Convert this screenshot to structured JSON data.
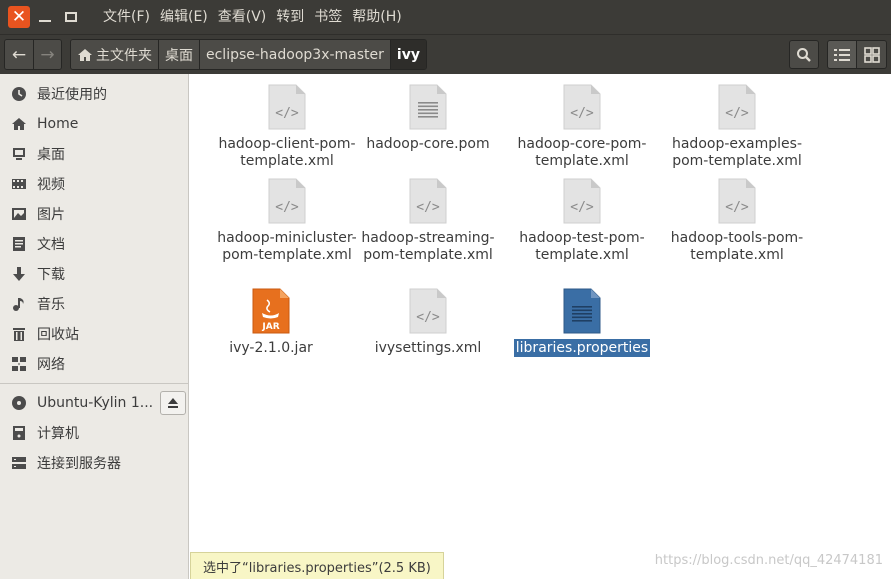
{
  "titlebar": {
    "menus": [
      "文件(F)",
      "编辑(E)",
      "查看(V)",
      "转到",
      "书签",
      "帮助(H)"
    ]
  },
  "toolbar": {
    "breadcrumbs": [
      "主文件夹",
      "桌面",
      "eclipse-hadoop3x-master",
      "ivy"
    ]
  },
  "sidebar": {
    "items": [
      "最近使用的",
      "Home",
      "桌面",
      "视频",
      "图片",
      "文档",
      "下载",
      "音乐",
      "回收站",
      "网络"
    ],
    "devices": [
      "Ubuntu-Kylin 1...",
      "计算机",
      "连接到服务器"
    ]
  },
  "files": [
    {
      "name": "hadoop-client-pom-template.xml",
      "type": "code"
    },
    {
      "name": "hadoop-core.pom",
      "type": "text"
    },
    {
      "name": "hadoop-core-pom-template.xml",
      "type": "code"
    },
    {
      "name": "hadoop-examples-pom-template.xml",
      "type": "code"
    },
    {
      "name": "hadoop-minicluster-pom-template.xml",
      "type": "code"
    },
    {
      "name": "hadoop-streaming-pom-template.xml",
      "type": "code"
    },
    {
      "name": "hadoop-test-pom-template.xml",
      "type": "code"
    },
    {
      "name": "hadoop-tools-pom-template.xml",
      "type": "code"
    },
    {
      "name": "ivy-2.1.0.jar",
      "type": "jar"
    },
    {
      "name": "ivysettings.xml",
      "type": "code"
    },
    {
      "name": "libraries.properties",
      "type": "text-selected"
    }
  ],
  "jar_badge": "JAR",
  "status": "选中了“libraries.properties”(2.5 KB)",
  "watermark": "https://blog.csdn.net/qq_42474181",
  "colors": {
    "accent": "#e9541f",
    "selection": "#3a6ea5",
    "jar": "#e7701e"
  }
}
